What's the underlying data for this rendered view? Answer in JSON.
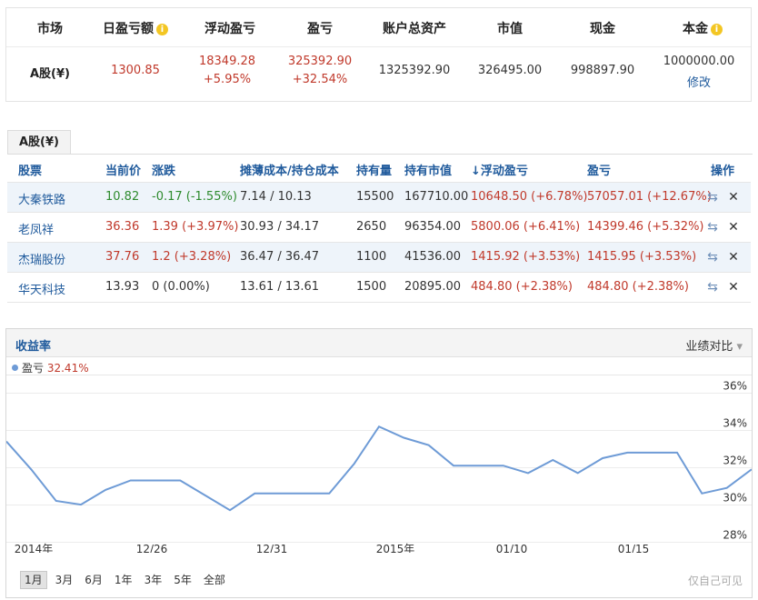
{
  "summary": {
    "headers": [
      "市场",
      "日盈亏额",
      "浮动盈亏",
      "盈亏",
      "账户总资产",
      "市值",
      "现金",
      "本金"
    ],
    "market": "A股(¥)",
    "daily_pl": "1300.85",
    "float_pl": "18349.28",
    "float_pl_pct": "+5.95%",
    "pl": "325392.90",
    "pl_pct": "+32.54%",
    "total_assets": "1325392.90",
    "market_value": "326495.00",
    "cash": "998897.90",
    "principal": "1000000.00",
    "modify_label": "修改",
    "info_icon": "i"
  },
  "tab_label": "A股(¥)",
  "holdings": {
    "columns": [
      "股票",
      "当前价",
      "涨跌",
      "摊薄成本/持仓成本",
      "持有量",
      "持有市值",
      "浮动盈亏",
      "盈亏",
      "操作"
    ],
    "sort_arrow": "↓",
    "rows": [
      {
        "name": "大秦铁路",
        "price": "10.82",
        "change": "-0.17 (-1.55%)",
        "cost": "7.14 / 10.13",
        "qty": "15500",
        "mv": "167710.00",
        "float": "10648.50 (+6.78%)",
        "pl": "57057.01 (+12.67%)"
      },
      {
        "name": "老凤祥",
        "price": "36.36",
        "change": "1.39 (+3.97%)",
        "cost": "30.93 / 34.17",
        "qty": "2650",
        "mv": "96354.00",
        "float": "5800.06 (+6.41%)",
        "pl": "14399.46 (+5.32%)"
      },
      {
        "name": "杰瑞股份",
        "price": "37.76",
        "change": "1.2 (+3.28%)",
        "cost": "36.47 / 36.47",
        "qty": "1100",
        "mv": "41536.00",
        "float": "1415.92 (+3.53%)",
        "pl": "1415.95 (+3.53%)"
      },
      {
        "name": "华天科技",
        "price": "13.93",
        "change": "0 (0.00%)",
        "cost": "13.61 / 13.61",
        "qty": "1500",
        "mv": "20895.00",
        "float": "484.80 (+2.38%)",
        "pl": "484.80 (+2.38%)"
      }
    ],
    "transfer_icon": "⇆",
    "delete_icon": "✕"
  },
  "chart": {
    "title": "收益率",
    "compare_label": "业绩对比",
    "dropdown_icon": "▾",
    "legend_name": "盈亏",
    "legend_value": "32.41%",
    "range_buttons": [
      "1月",
      "3月",
      "6月",
      "1年",
      "3年",
      "5年",
      "全部"
    ],
    "active_range": "1月",
    "note": "仅自己可见"
  },
  "colors": {
    "line": "#6e9bd6",
    "red": "#c0392b",
    "green": "#2e8b2e",
    "link": "#1f5a9c"
  },
  "chart_data": {
    "type": "line",
    "series_name": "盈亏",
    "y_ticks": [
      "36%",
      "34%",
      "32%",
      "30%",
      "28%"
    ],
    "ylim": [
      28,
      37
    ],
    "x_ticks": [
      "2014年",
      "12/26",
      "12/31",
      "2015年",
      "01/10",
      "01/15"
    ],
    "y": [
      33.4,
      31.9,
      30.2,
      30.0,
      30.8,
      31.3,
      31.3,
      31.3,
      30.5,
      29.7,
      30.6,
      30.6,
      30.6,
      30.6,
      32.2,
      34.2,
      33.6,
      33.2,
      32.1,
      32.1,
      32.1,
      31.7,
      32.4,
      31.7,
      32.5,
      32.8,
      32.8,
      32.8,
      30.6,
      30.9,
      31.9
    ]
  }
}
